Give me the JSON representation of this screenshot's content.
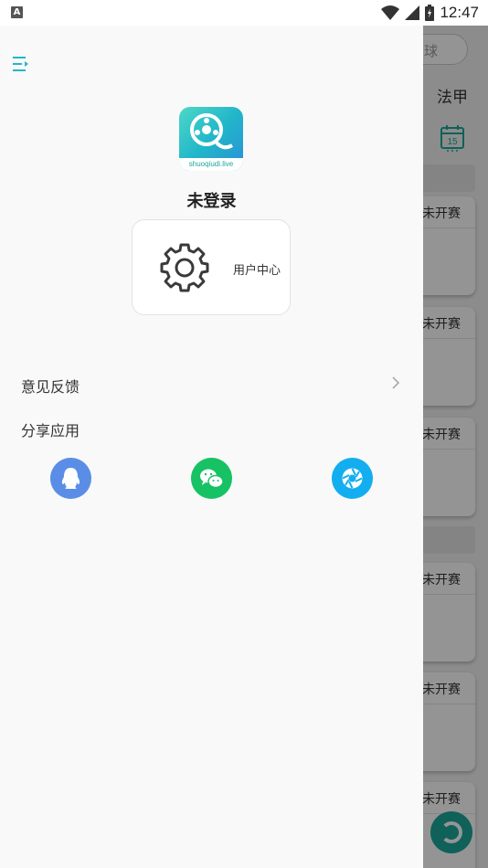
{
  "status_bar": {
    "time": "12:47",
    "notification_glyph": "A"
  },
  "background_app": {
    "search_placeholder": "球",
    "tab_label": "法甲",
    "calendar_day": "15",
    "match_status": [
      "未开赛",
      "未开赛",
      "未开赛",
      "未开赛",
      "未开赛",
      "未开赛"
    ]
  },
  "drawer": {
    "menu_icon": "menu-collapse-icon",
    "logo": {
      "text": "shuoqiudi.live",
      "icon": "soccer-ball-film-icon"
    },
    "login_status": "未登录",
    "user_center": {
      "label": "用户中心",
      "icon": "gear-icon"
    },
    "feedback_label": "意见反馈",
    "share_label": "分享应用",
    "share_targets": [
      {
        "name": "QQ",
        "icon": "qq-icon",
        "color": "#5a8ee6"
      },
      {
        "name": "WeChat",
        "icon": "wechat-icon",
        "color": "#17c264"
      },
      {
        "name": "Moments",
        "icon": "wechat-moments-icon",
        "color": "#12aef0"
      }
    ]
  },
  "colors": {
    "accent": "#22b6c9",
    "drawer_bg": "#f9f9f9",
    "scrim": "rgba(0,0,0,0.42)"
  }
}
